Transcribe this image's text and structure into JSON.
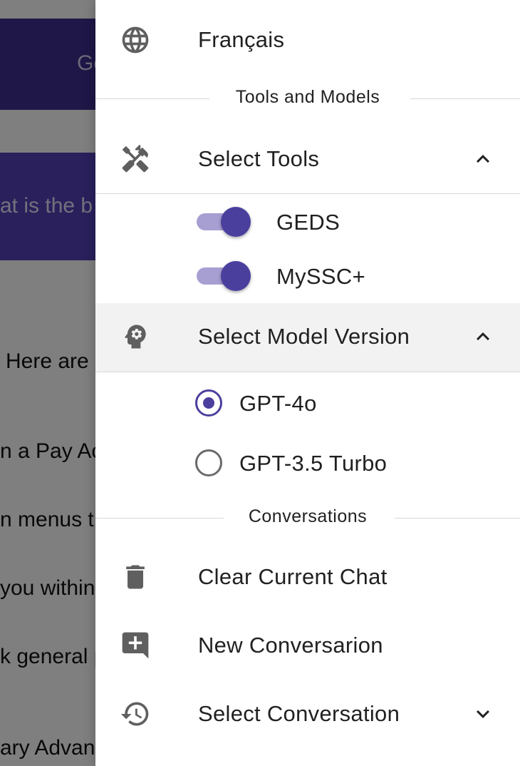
{
  "background": {
    "header_text": "Ge",
    "user_message": "at is the b",
    "reply_lines": [
      "Here are",
      "n a Pay Ac",
      "n menus t",
      "you within",
      "k general p",
      "ary Advanc"
    ]
  },
  "drawer": {
    "language": {
      "label": "Français",
      "icon": "globe-icon"
    },
    "tools_section_title": "Tools and Models",
    "select_tools": {
      "label": "Select Tools",
      "icon": "tools-icon",
      "expanded": true
    },
    "tools": [
      {
        "label": "GEDS",
        "enabled": true
      },
      {
        "label": "MySSC+",
        "enabled": true
      }
    ],
    "select_model": {
      "label": "Select Model Version",
      "icon": "psychology-icon",
      "expanded": true
    },
    "models": [
      {
        "label": "GPT-4o",
        "selected": true
      },
      {
        "label": "GPT-3.5 Turbo",
        "selected": false
      }
    ],
    "conversations_section_title": "Conversations",
    "clear_chat": {
      "label": "Clear Current Chat",
      "icon": "trash-icon"
    },
    "new_conversation": {
      "label": "New Conversarion",
      "icon": "add-comment-icon"
    },
    "select_conversation": {
      "label": "Select Conversation",
      "icon": "history-icon",
      "expanded": false
    }
  },
  "colors": {
    "accent": "#4b3f9e",
    "toggle_track": "#a79fd2",
    "highlight_row": "#f2f2f2"
  }
}
